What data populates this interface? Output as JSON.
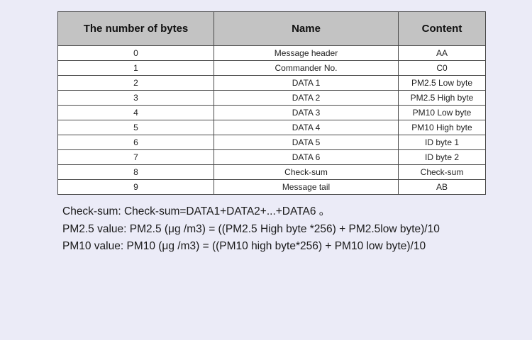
{
  "table": {
    "headers": [
      "The number of bytes",
      "Name",
      "Content"
    ],
    "rows": [
      {
        "byte": "0",
        "name": "Message header",
        "content": "AA"
      },
      {
        "byte": "1",
        "name": "Commander No.",
        "content": "C0"
      },
      {
        "byte": "2",
        "name": "DATA 1",
        "content": "PM2.5 Low byte"
      },
      {
        "byte": "3",
        "name": "DATA 2",
        "content": "PM2.5 High byte"
      },
      {
        "byte": "4",
        "name": "DATA 3",
        "content": "PM10 Low byte"
      },
      {
        "byte": "5",
        "name": "DATA 4",
        "content": "PM10 High byte"
      },
      {
        "byte": "6",
        "name": "DATA 5",
        "content": "ID byte 1"
      },
      {
        "byte": "7",
        "name": "DATA 6",
        "content": "ID byte 2"
      },
      {
        "byte": "8",
        "name": "Check-sum",
        "content": "Check-sum"
      },
      {
        "byte": "9",
        "name": "Message tail",
        "content": "AB"
      }
    ]
  },
  "notes": [
    "Check-sum: Check-sum=DATA1+DATA2+...+DATA6 。",
    "PM2.5 value: PM2.5 (μg /m3) = ((PM2.5 High byte *256) + PM2.5low byte)/10",
    "PM10 value: PM10 (μg /m3) = ((PM10 high byte*256) + PM10 low byte)/10"
  ]
}
